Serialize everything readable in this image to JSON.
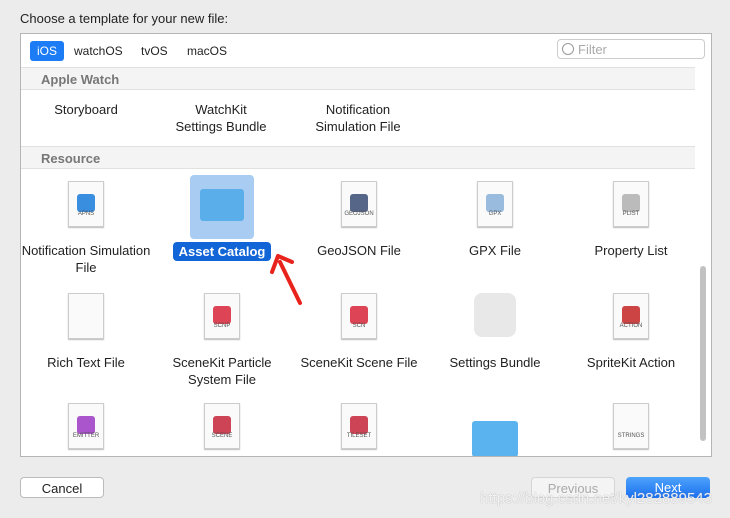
{
  "title": "Choose a template for your new file:",
  "tabs": [
    {
      "label": "iOS",
      "selected": true
    },
    {
      "label": "watchOS"
    },
    {
      "label": "tvOS"
    },
    {
      "label": "macOS"
    }
  ],
  "filter": {
    "placeholder": "Filter"
  },
  "sections": [
    {
      "header": "Apple Watch",
      "items": [
        "Storyboard",
        "WatchKit\nSettings Bundle",
        "Notification\nSimulation File"
      ]
    },
    {
      "header": "Resource",
      "items": [
        {
          "label": "Notification Simulation File",
          "icon_tag": "APNS"
        },
        {
          "label": "Asset Catalog",
          "selected": true
        },
        {
          "label": "GeoJSON File",
          "icon_tag": "GEOJSON"
        },
        {
          "label": "GPX File",
          "icon_tag": "GPX"
        },
        {
          "label": "Property List",
          "icon_tag": "PLIST"
        },
        {
          "label": "Rich Text File"
        },
        {
          "label": "SceneKit Particle System File",
          "icon_tag": "SCNP"
        },
        {
          "label": "SceneKit Scene File",
          "icon_tag": "SCN"
        },
        {
          "label": "Settings Bundle"
        },
        {
          "label": "SpriteKit Action",
          "icon_tag": "ACTION"
        },
        {
          "icon_tag": "EMITTER"
        },
        {
          "icon_tag": "SCENE"
        },
        {
          "icon_tag": "TILESET"
        },
        {
          "icon_tag": ""
        },
        {
          "icon_tag": "STRINGS"
        }
      ]
    }
  ],
  "buttons": {
    "cancel": "Cancel",
    "previous": "Previous",
    "next": "Next"
  },
  "watermark": "https://blog.csdn.net/kyl282889543",
  "colors": {
    "accent": "#1b7cf5",
    "arrow": "#e8231b"
  }
}
